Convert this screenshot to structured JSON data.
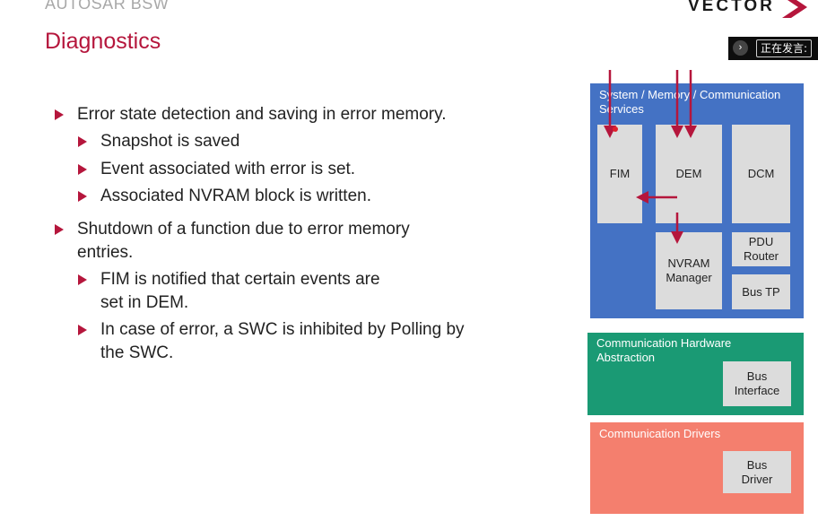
{
  "header": {
    "overline": "AUTOSAR BSW",
    "title": "Diagnostics",
    "logo": "VECTOR",
    "speaking_label": "正在发言:",
    "speaking_icon": "chevron-right-icon"
  },
  "bullets": [
    {
      "text": "Error state detection and saving in error memory."
    },
    {
      "text": "Snapshot is saved"
    },
    {
      "text": "Event associated with error is set."
    },
    {
      "text": "Associated NVRAM block is written."
    },
    {
      "text": "Shutdown of a function due to error memory",
      "text2": "entries."
    },
    {
      "text": "FIM is notified that certain events are",
      "text2": "set in DEM."
    },
    {
      "text": "In case of error, a SWC is inhibited by Polling by",
      "text2": "the SWC."
    }
  ],
  "diagram": {
    "services": {
      "label": "System / Memory / Communication Services",
      "color": "#4472c4",
      "fim": "FIM",
      "dem": "DEM",
      "dcm": "DCM",
      "nvram": "NVRAM Manager",
      "pdu_router": "PDU Router",
      "bus_tp": "Bus TP"
    },
    "hw_abstraction": {
      "label": "Communication Hardware Abstraction",
      "color": "#1a9a74",
      "bus_interface": "Bus Interface"
    },
    "drivers": {
      "label": "Communication Drivers",
      "color": "#f47f6e",
      "bus_driver": "Bus Driver"
    },
    "arrow_color": "#b5163c"
  }
}
